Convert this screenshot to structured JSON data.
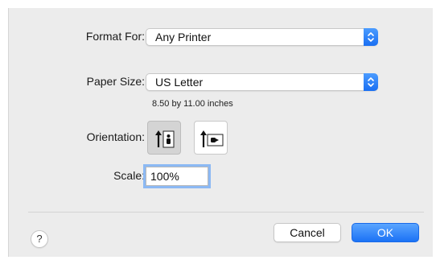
{
  "format_for": {
    "label": "Format For:",
    "value": "Any Printer",
    "icon": "stepper-arrows-icon"
  },
  "paper_size": {
    "label": "Paper Size:",
    "value": "US Letter",
    "dimensions": "8.50 by 11.00 inches",
    "icon": "stepper-arrows-icon"
  },
  "orientation": {
    "label": "Orientation:",
    "selected": "portrait",
    "options": [
      "portrait",
      "landscape"
    ]
  },
  "scale": {
    "label": "Scale:",
    "value": "100%"
  },
  "buttons": {
    "help": "?",
    "cancel": "Cancel",
    "ok": "OK"
  },
  "colors": {
    "accent": "#1b72f5",
    "dialog_bg": "#ececec"
  }
}
